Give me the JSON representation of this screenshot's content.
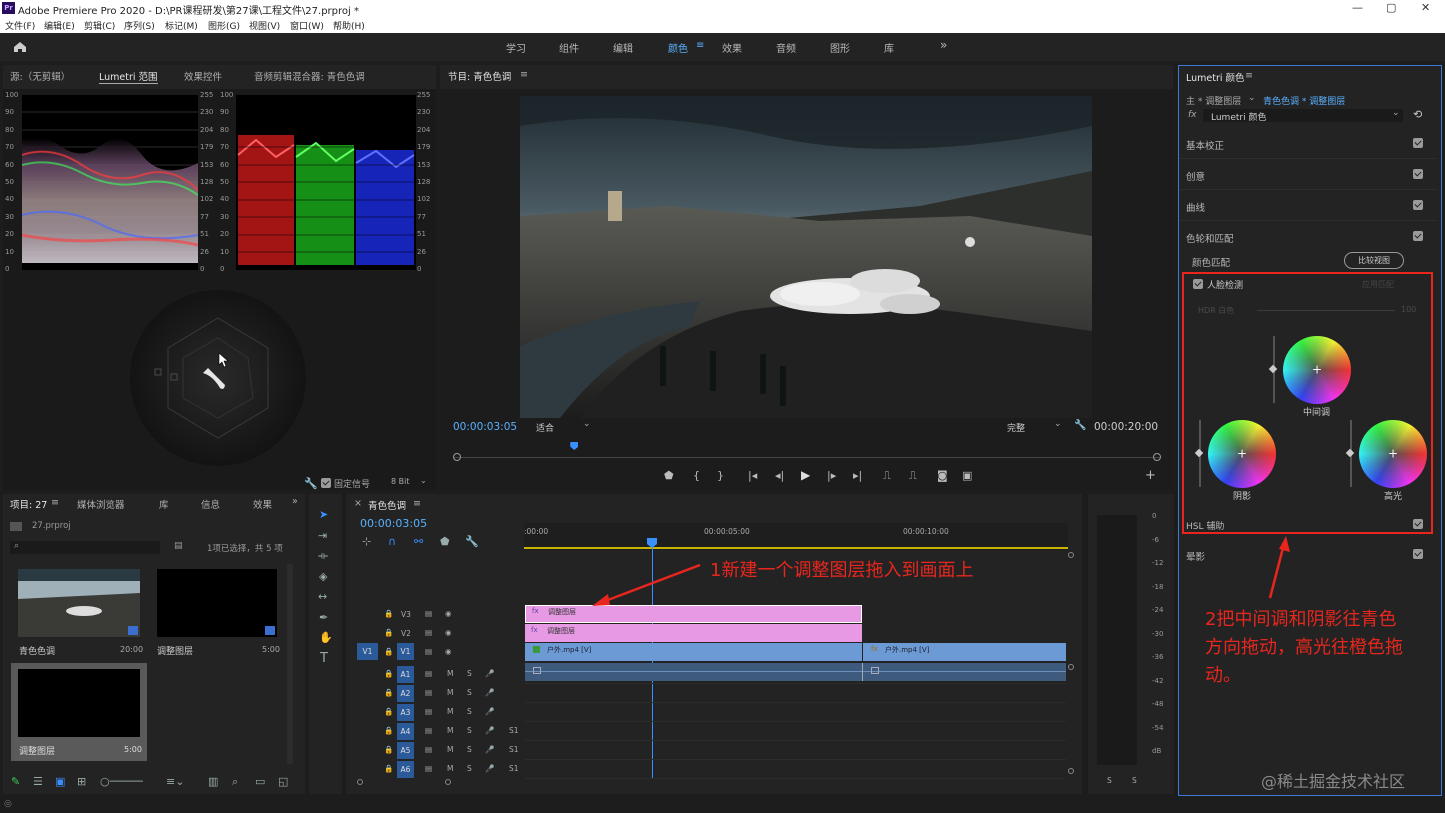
{
  "app": {
    "logo_text": "Pr",
    "title": "Adobe Premiere Pro 2020 - D:\\PR课程研发\\第27课\\工程文件\\27.prproj *"
  },
  "window_controls": {
    "minimize": "—",
    "maximize": "▢",
    "close": "✕"
  },
  "menu": [
    "文件(F)",
    "编辑(E)",
    "剪辑(C)",
    "序列(S)",
    "标记(M)",
    "图形(G)",
    "视图(V)",
    "窗口(W)",
    "帮助(H)"
  ],
  "workspaces": {
    "items": [
      "学习",
      "组件",
      "编辑",
      "颜色",
      "效果",
      "音频",
      "图形",
      "库"
    ],
    "active": "颜色",
    "more": "»",
    "active_menu_icon": "≡"
  },
  "source_panel": {
    "tabs": [
      "源:（无剪辑）",
      "Lumetri 范围",
      "效果控件",
      "音频剪辑混合器: 青色色调"
    ],
    "active": "Lumetri 范围"
  },
  "scopes": {
    "left_axis": [
      "100",
      "90",
      "80",
      "70",
      "60",
      "50",
      "40",
      "30",
      "20",
      "10",
      "0"
    ],
    "right_axis": [
      "255",
      "230",
      "204",
      "179",
      "153",
      "128",
      "102",
      "77",
      "51",
      "26",
      "0"
    ],
    "clamp_label": "固定信号",
    "bit_depth": "8 Bit"
  },
  "program": {
    "title": "节目: 青色色调",
    "timecode": "00:00:03:05",
    "fit": "适合",
    "quality": "完整",
    "duration": "00:00:20:00",
    "playhead_fraction": 0.16
  },
  "project": {
    "tabs": [
      "项目: 27",
      "媒体浏览器",
      "库",
      "信息",
      "效果"
    ],
    "file": "27.prproj",
    "selection": "1项已选择，共 5 项",
    "items": [
      {
        "name": "青色色调",
        "duration": "20:00"
      },
      {
        "name": "调整图层",
        "duration": "5:00"
      },
      {
        "name": "调整图层",
        "duration": "5:00"
      }
    ]
  },
  "timeline": {
    "title": "青色色调",
    "timecode": "00:00:03:05",
    "ruler": [
      ":00:00",
      "00:00:05:00",
      "00:00:10:00"
    ],
    "video_tracks": [
      {
        "name": "V3",
        "clip": "调整图层"
      },
      {
        "name": "V2",
        "clip": "调整图层"
      },
      {
        "name": "V1",
        "clip": "户外.mp4 [V]",
        "clip2": "户外.mp4 [V]",
        "source": "V1"
      }
    ],
    "audio_tracks": [
      "A1",
      "A2",
      "A3",
      "A4",
      "A5",
      "A6"
    ],
    "track_btns": {
      "m": "M",
      "s": "S"
    },
    "level_labels": [
      "S1",
      "S1",
      "S1"
    ]
  },
  "meter": {
    "ticks": [
      "0",
      "-6",
      "-12",
      "-18",
      "-24",
      "-30",
      "-36",
      "-42",
      "-48",
      "-54",
      "dB"
    ],
    "solo": [
      "S",
      "S"
    ]
  },
  "lumetri": {
    "title": "Lumetri 颜色",
    "source": "主 * 调整图层",
    "target": "青色色调 * 调整图层",
    "effect": "Lumetri 颜色",
    "sections": [
      "基本校正",
      "创意",
      "曲线",
      "色轮和匹配"
    ],
    "color_match": "颜色匹配",
    "compare_btn": "比较视图",
    "face_detect": "人脸检测",
    "apply_match": "应用匹配",
    "hdr_label": "HDR 白色",
    "hdr_value": "100",
    "wheels": {
      "midtones": "中间调",
      "shadows": "阴影",
      "highlights": "高光"
    },
    "hsl": "HSL 辅助",
    "vignette": "晕影"
  },
  "annotations": {
    "step1": "1新建一个调整图层拖入到画面上",
    "step2_lines": [
      "2把中间调和阴影往青色",
      "方向拖动，高光往橙色拖",
      "动。"
    ]
  },
  "watermark": "@稀土掘金技术社区"
}
